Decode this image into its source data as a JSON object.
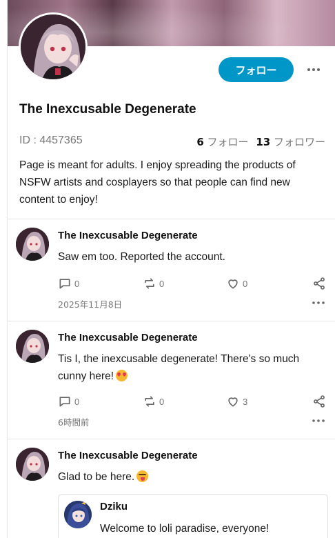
{
  "profile": {
    "name": "The Inexcusable Degenerate",
    "id_text": "ID : 4457365",
    "follow_button": "フォロー",
    "following_count": "6",
    "following_label": "フォロー",
    "followers_count": "13",
    "followers_label": "フォロワー",
    "bio": "Page is meant for adults. I enjoy spreading the products of NSFW artists and cosplayers so that people can find new content to enjoy!"
  },
  "posts": [
    {
      "author": "The Inexcusable Degenerate",
      "text": "Saw em too. Reported the account.",
      "emoji": "",
      "replies": "0",
      "reposts": "0",
      "likes": "0",
      "date": "2025年11月8日"
    },
    {
      "author": "The Inexcusable Degenerate",
      "text": "Tis I, the inexcusable degenerate! There's so much cunny here!",
      "emoji": "smiling-face-with-heart-eyes",
      "replies": "0",
      "reposts": "0",
      "likes": "3",
      "date": "6時間前"
    },
    {
      "author": "The Inexcusable Degenerate",
      "text": "Glad to be here.",
      "emoji": "face-with-tongue",
      "quote": {
        "author": "Dziku",
        "text": "Welcome to loli paradise, everyone!"
      }
    }
  ],
  "colors": {
    "accent": "#0096c7",
    "muted_text": "#777777",
    "divider": "#e6e6e6"
  }
}
